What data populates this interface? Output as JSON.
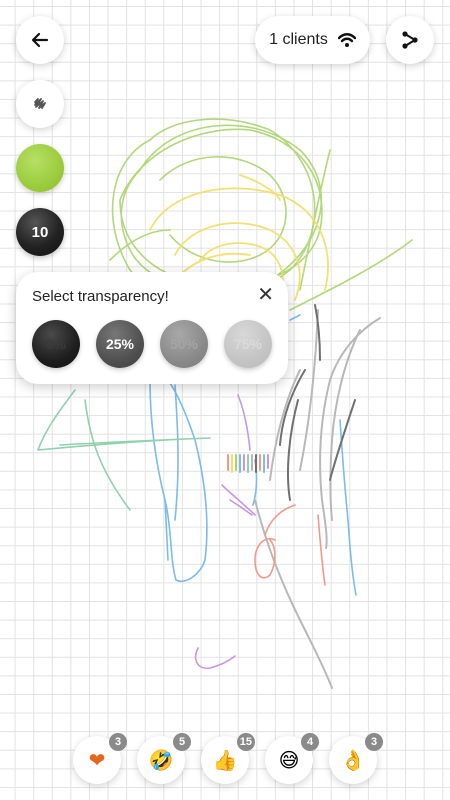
{
  "header": {
    "back_icon": "arrow-left-icon",
    "clients_label": "1 clients",
    "clients_icon": "wifi-icon",
    "share_icon": "share-icon"
  },
  "toolbar": {
    "brush_icon": "scribble-brush-icon",
    "selected_color": "#9bcc3c",
    "brush_size": "10"
  },
  "transparency_popup": {
    "title": "Select transparency!",
    "close_icon": "close-icon",
    "options": [
      "0%",
      "25%",
      "50%",
      "75%"
    ],
    "selected": "25%"
  },
  "reactions": [
    {
      "icon": "heart-icon",
      "emoji": "❤",
      "count": "3"
    },
    {
      "icon": "rofl-emoji-icon",
      "emoji": "🤣",
      "count": "5"
    },
    {
      "icon": "thumbs-up-icon",
      "emoji": "👍",
      "count": "15"
    },
    {
      "icon": "grin-sweat-emoji-icon",
      "emoji": "😅",
      "count": "4"
    },
    {
      "icon": "ok-hand-icon",
      "emoji": "👌",
      "count": "3"
    }
  ]
}
